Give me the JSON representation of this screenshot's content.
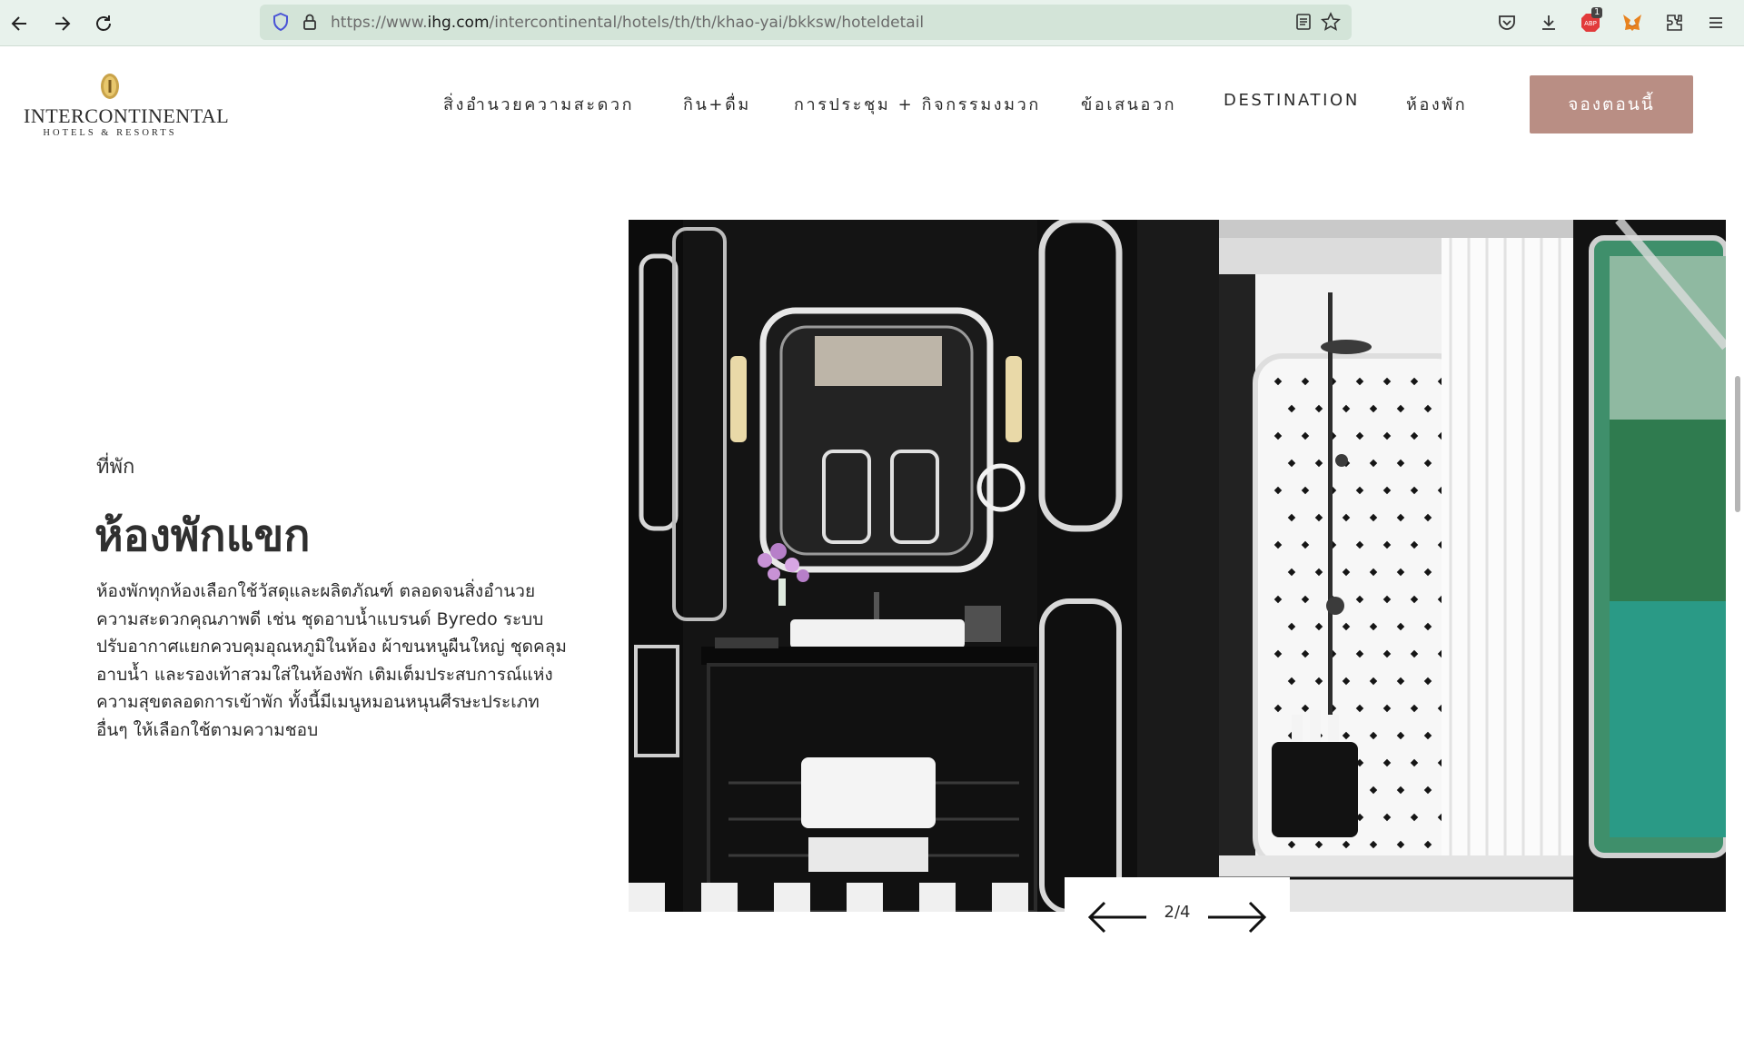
{
  "browser": {
    "url_prefix": "https://www.",
    "url_host": "ihg.com",
    "url_path": "/intercontinental/hotels/th/th/khao-yai/bkksw/hoteldetail",
    "extension_badge": "1",
    "icons": [
      "back-arrow-icon",
      "forward-arrow-icon",
      "reload-icon",
      "shield-icon",
      "lock-icon",
      "reader-mode-icon",
      "bookmark-star-icon",
      "pocket-icon",
      "download-icon",
      "adblock-icon",
      "metamask-icon",
      "extensions-icon",
      "menu-icon"
    ]
  },
  "header": {
    "logo": {
      "brand": "INTERCONTINENTAL",
      "tagline": "HOTELS & RESORTS"
    },
    "nav": [
      {
        "label": "สิ่งอำนวยความสะดวก"
      },
      {
        "label": "กิน+ดื่ม"
      },
      {
        "label": "การประชุม + กิจกรรมงมวก"
      },
      {
        "label": "ข้อเสนอวก"
      },
      {
        "label": "DESTINATION"
      },
      {
        "label": "ห้องพัก"
      }
    ],
    "book_button": "จองตอนนี้"
  },
  "content": {
    "eyebrow": "ที่พัก",
    "title": "ห้องพักแขก",
    "description": "ห้องพักทุกห้องเลือกใช้วัสดุและผลิตภัณฑ์ ตลอดจนสิ่งอำนวยความสะดวกคุณภาพดี เช่น ชุดอาบน้ำแบรนด์ Byredo ระบบปรับอากาศแยกควบคุมอุณหภูมิในห้อง ผ้าขนหนูผืนใหญ่ ชุดคลุมอาบน้ำ และรองเท้าสวมใส่ในห้องพัก เติมเต็มประสบการณ์แห่งความสุขตลอดการเข้าพัก ทั้งนี้มีเมนูหมอนหนุนศีรษะประเภทอื่นๆ ให้เลือกใช้ตามความชอบ"
  },
  "gallery": {
    "counter": "2/4",
    "current": 2,
    "total": 4
  },
  "colors": {
    "chrome_bg": "#e8f2ec",
    "urlbar_bg": "#d3e4d8",
    "book_button_bg": "#b98e84",
    "text": "#2b2b2b"
  }
}
